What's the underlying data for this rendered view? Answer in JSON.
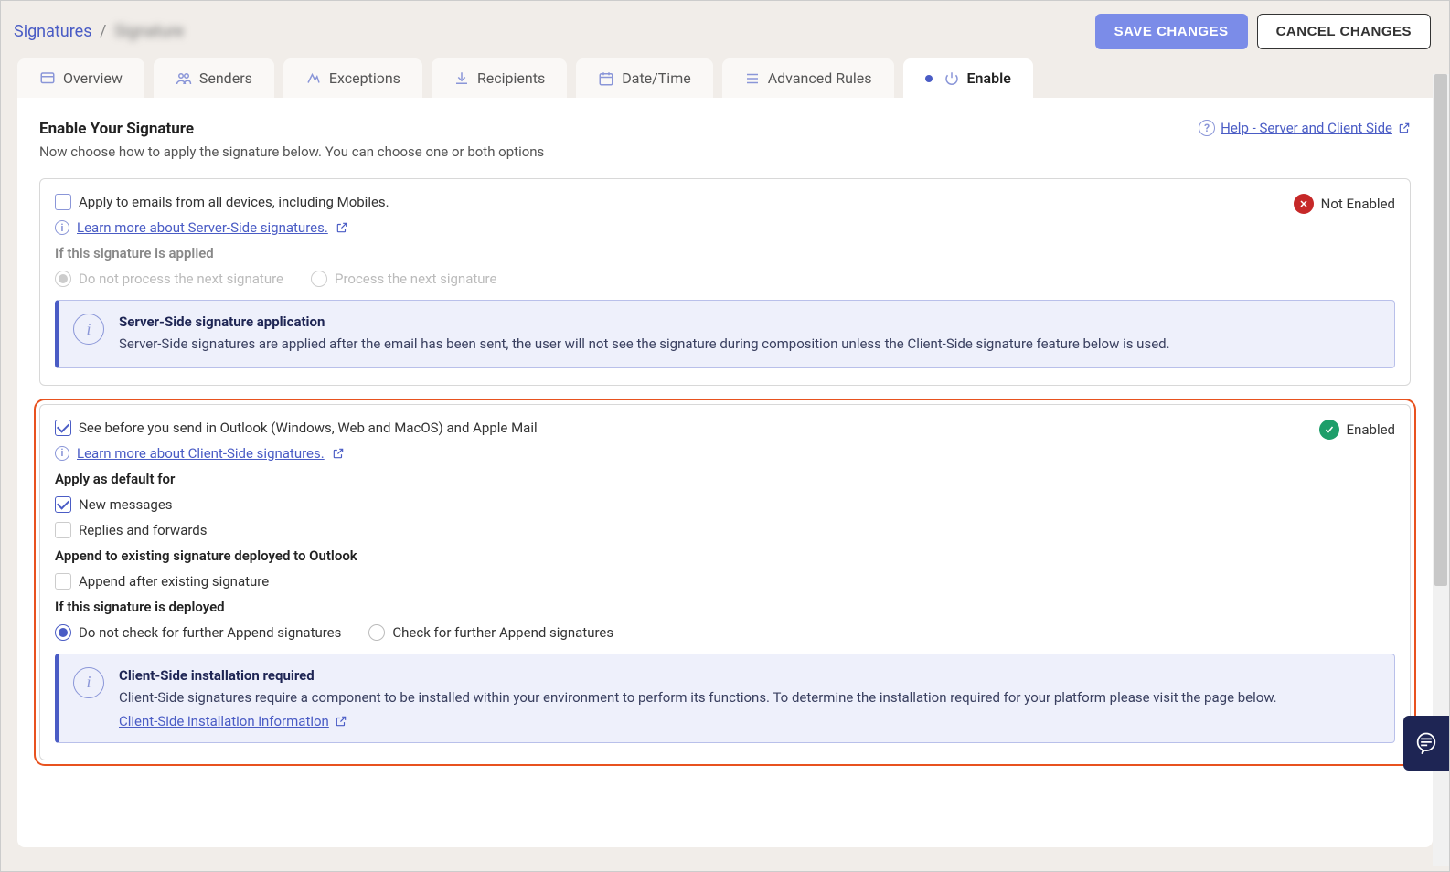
{
  "breadcrumb": {
    "root": "Signatures",
    "sep": "/",
    "current": "Signature"
  },
  "header": {
    "save": "SAVE CHANGES",
    "cancel": "CANCEL CHANGES"
  },
  "tabs": [
    {
      "label": "Overview"
    },
    {
      "label": "Senders"
    },
    {
      "label": "Exceptions"
    },
    {
      "label": "Recipients"
    },
    {
      "label": "Date/Time"
    },
    {
      "label": "Advanced Rules"
    },
    {
      "label": "Enable"
    }
  ],
  "page": {
    "title": "Enable Your Signature",
    "subtitle": "Now choose how to apply the signature below. You can choose one or both options",
    "help": "Help - Server and Client Side"
  },
  "server": {
    "checkbox_label": "Apply to emails from all devices, including Mobiles.",
    "learn_more": "Learn more about Server-Side signatures.",
    "if_applied": "If this signature is applied",
    "opt_dont": "Do not process the next signature",
    "opt_process": "Process the next signature",
    "status": "Not Enabled",
    "callout_title": "Server-Side signature application",
    "callout_body": "Server-Side signatures are applied after the email has been sent, the user will not see the signature during composition unless the Client-Side signature feature below is used."
  },
  "client": {
    "checkbox_label": "See before you send in Outlook (Windows, Web and MacOS) and Apple Mail",
    "learn_more": "Learn more about Client-Side signatures.",
    "status": "Enabled",
    "apply_default": "Apply as default for",
    "new_msgs": "New messages",
    "replies": "Replies and forwards",
    "append_heading": "Append to existing signature deployed to Outlook",
    "append_after": "Append after existing signature",
    "if_deployed": "If this signature is deployed",
    "opt_dont": "Do not check for further Append signatures",
    "opt_check": "Check for further Append signatures",
    "callout_title": "Client-Side installation required",
    "callout_body": "Client-Side signatures require a component to be installed within your environment to perform its functions. To determine the installation required for your platform please visit the page below.",
    "callout_link": "Client-Side installation information"
  }
}
